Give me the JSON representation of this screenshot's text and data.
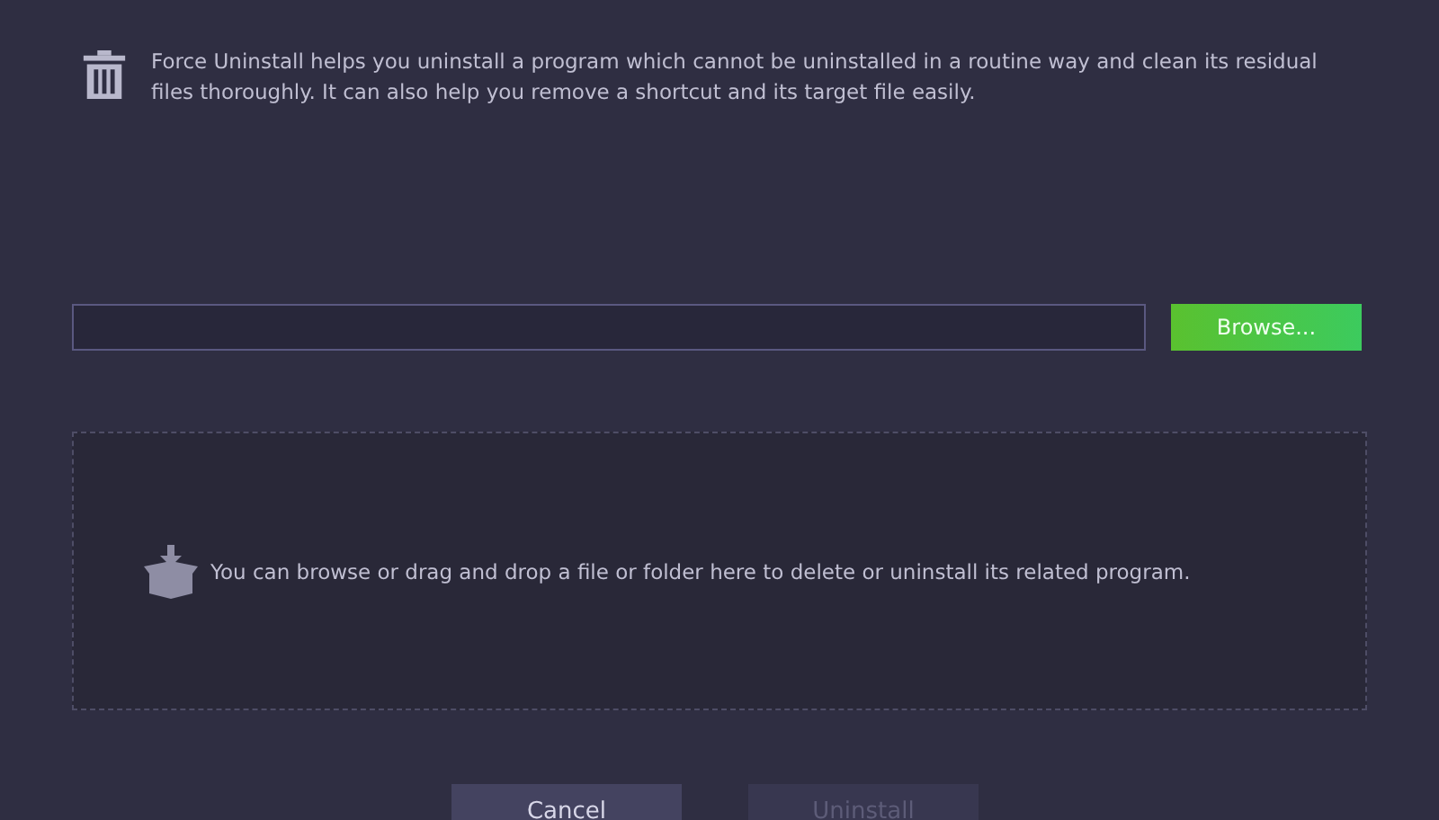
{
  "description": "Force Uninstall helps you uninstall a program which cannot be uninstalled in a routine way and clean its residual files thoroughly. It can also help you remove a shortcut and its target file easily.",
  "browse_button": "Browse...",
  "drop_zone": {
    "text": "You can browse or drag and drop a file or folder here to delete or uninstall its related program."
  },
  "buttons": [
    {
      "label": "Cancel",
      "disabled": false
    },
    {
      "label": "Uninstall",
      "disabled": true
    }
  ]
}
